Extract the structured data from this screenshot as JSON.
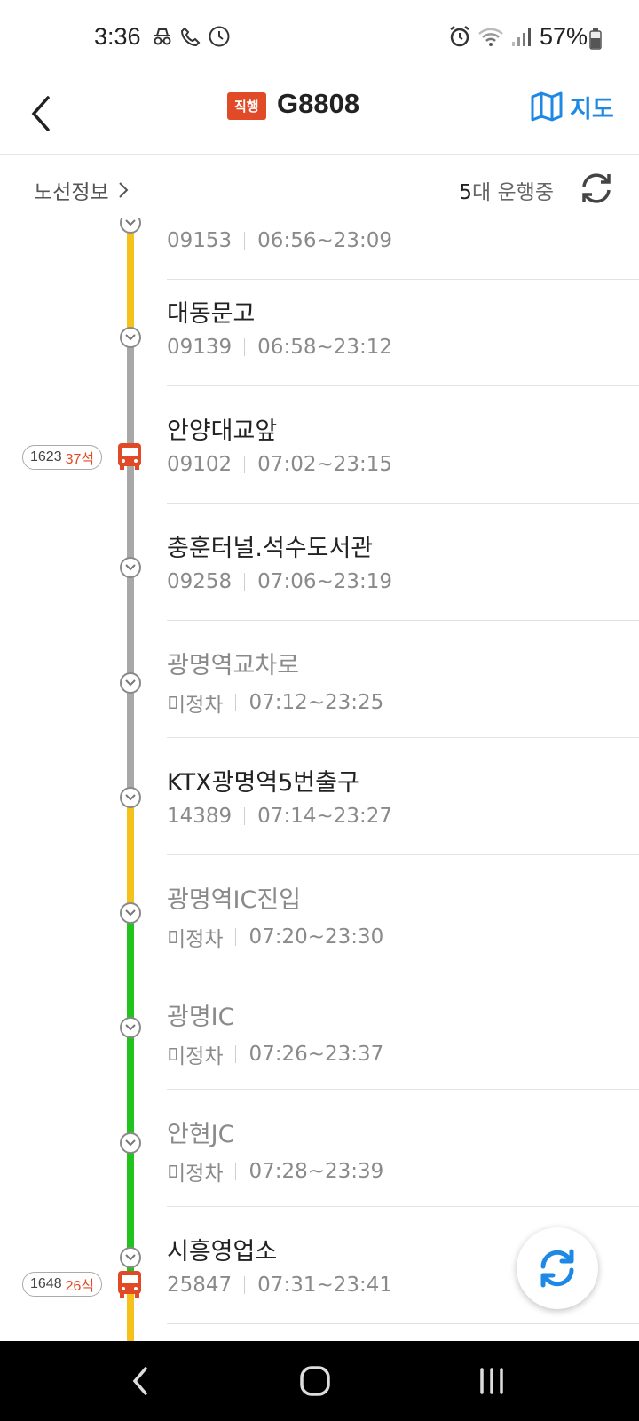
{
  "status_bar": {
    "time": "3:36",
    "battery": "57%"
  },
  "header": {
    "badge": "직행",
    "route_number": "G8808",
    "map_label": "지도"
  },
  "subheader": {
    "route_info": "노선정보",
    "running_count": "5",
    "running_suffix": "대 운행중"
  },
  "colors": {
    "accent": "#1e88e5",
    "badge_red": "#e04a27",
    "line_yellow": "#f5c21b",
    "line_gray": "#a8a8a8",
    "line_green": "#22c31e"
  },
  "stops": [
    {
      "name": "",
      "id": "09153",
      "hours": "06:56~23:09",
      "active": true
    },
    {
      "name": "대동문고",
      "id": "09139",
      "hours": "06:58~23:12",
      "active": true
    },
    {
      "name": "안양대교앞",
      "id": "09102",
      "hours": "07:02~23:15",
      "active": true
    },
    {
      "name": "충훈터널.석수도서관",
      "id": "09258",
      "hours": "07:06~23:19",
      "active": true
    },
    {
      "name": "광명역교차로",
      "id": "미정차",
      "hours": "07:12~23:25",
      "active": false
    },
    {
      "name": "KTX광명역5번출구",
      "id": "14389",
      "hours": "07:14~23:27",
      "active": true
    },
    {
      "name": "광명역IC진입",
      "id": "미정차",
      "hours": "07:20~23:30",
      "active": false
    },
    {
      "name": "광명IC",
      "id": "미정차",
      "hours": "07:26~23:37",
      "active": false
    },
    {
      "name": "안현JC",
      "id": "미정차",
      "hours": "07:28~23:39",
      "active": false
    },
    {
      "name": "시흥영업소",
      "id": "25847",
      "hours": "07:31~23:41",
      "active": true
    }
  ],
  "buses": [
    {
      "plate": "1623",
      "seats": "37석"
    },
    {
      "plate": "1648",
      "seats": "26석"
    }
  ]
}
